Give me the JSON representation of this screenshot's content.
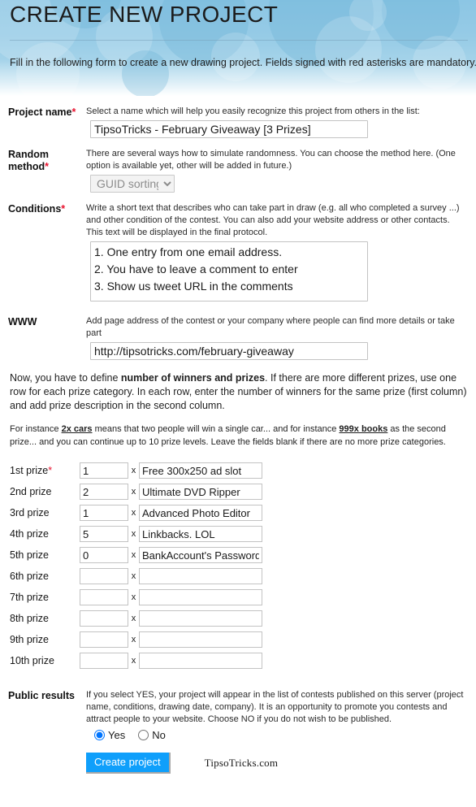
{
  "header": {
    "title": "CREATE NEW PROJECT",
    "intro": "Fill in the following form to create a new drawing project. Fields signed with red asterisks are mandatory.",
    "accent_color": "#8cc6e4"
  },
  "form": {
    "project_name": {
      "label": "Project name",
      "required_marker": "*",
      "help": "Select a name which will help you easily recognize this project from others in the list:",
      "value": "TipsoTricks - February Giveaway [3 Prizes]",
      "placeholder": ""
    },
    "random_method": {
      "label": "Random method",
      "required_marker": "*",
      "help": "There are several ways how to simulate randomness. You can choose the method here. (One option is available yet, other will be added in future.)",
      "selected": "GUID sorting",
      "options": [
        "GUID sorting"
      ]
    },
    "conditions": {
      "label": "Conditions",
      "required_marker": "*",
      "help": "Write a short text that describes who can take part in draw (e.g. all who completed a survey ...) and other condition of the contest. You can also add your website address or other contacts. This text will be displayed in the final protocol.",
      "value": "1. One entry from one email address.\n2. You have to leave a comment to enter\n3. Show us tweet URL in the comments",
      "placeholder": ""
    },
    "www": {
      "label": "WWW",
      "required_marker": "",
      "help": "Add page address of the contest or your company where people can find more details or take part",
      "value": "http://tipsotricks.com/february-giveaway",
      "placeholder": ""
    },
    "public_results": {
      "label": "Public results",
      "required_marker": "",
      "help": "If you select YES, your project will appear in the list of contests published on this server (project name, conditions, drawing date, company). It is an opportunity to promote you contests and attract people to your website. Choose NO if you do not wish to be published.",
      "options": [
        {
          "label": "Yes",
          "selected": true
        },
        {
          "label": "No",
          "selected": false
        }
      ]
    }
  },
  "prizes_intro": {
    "paragraph1_a": "Now, you have to define ",
    "paragraph1_bold": "number of winners and prizes",
    "paragraph1_b": ". If there are more different prizes, use one row for each prize category. In each row, enter the number of winners for the same prize (first column) and add prize description in the second column.",
    "paragraph2_a": "For instance ",
    "paragraph2_u1": "2x cars",
    "paragraph2_b": " means that two people will win a single car... and for instance ",
    "paragraph2_u2": "999x books",
    "paragraph2_c": " as the second prize... and you can continue up to 10 prize levels. Leave the fields blank if there are no more prize categories.",
    "multiplier_symbol": "x"
  },
  "prizes": [
    {
      "label": "1st prize",
      "required_marker": "*",
      "qty": "1",
      "desc": "Free 300x250 ad slot"
    },
    {
      "label": "2nd prize",
      "required_marker": "",
      "qty": "2",
      "desc": "Ultimate DVD Ripper"
    },
    {
      "label": "3rd prize",
      "required_marker": "",
      "qty": "1",
      "desc": "Advanced Photo Editor"
    },
    {
      "label": "4th prize",
      "required_marker": "",
      "qty": "5",
      "desc": "Linkbacks. LOL"
    },
    {
      "label": "5th prize",
      "required_marker": "",
      "qty": "0",
      "desc": "BankAccount's Password"
    },
    {
      "label": "6th prize",
      "required_marker": "",
      "qty": "",
      "desc": ""
    },
    {
      "label": "7th prize",
      "required_marker": "",
      "qty": "",
      "desc": ""
    },
    {
      "label": "8th prize",
      "required_marker": "",
      "qty": "",
      "desc": ""
    },
    {
      "label": "9th prize",
      "required_marker": "",
      "qty": "",
      "desc": ""
    },
    {
      "label": "10th prize",
      "required_marker": "",
      "qty": "",
      "desc": ""
    }
  ],
  "footer": {
    "submit_label": "Create project",
    "submit_color": "#0f9ffb",
    "brand": "TipsoTricks.com"
  }
}
